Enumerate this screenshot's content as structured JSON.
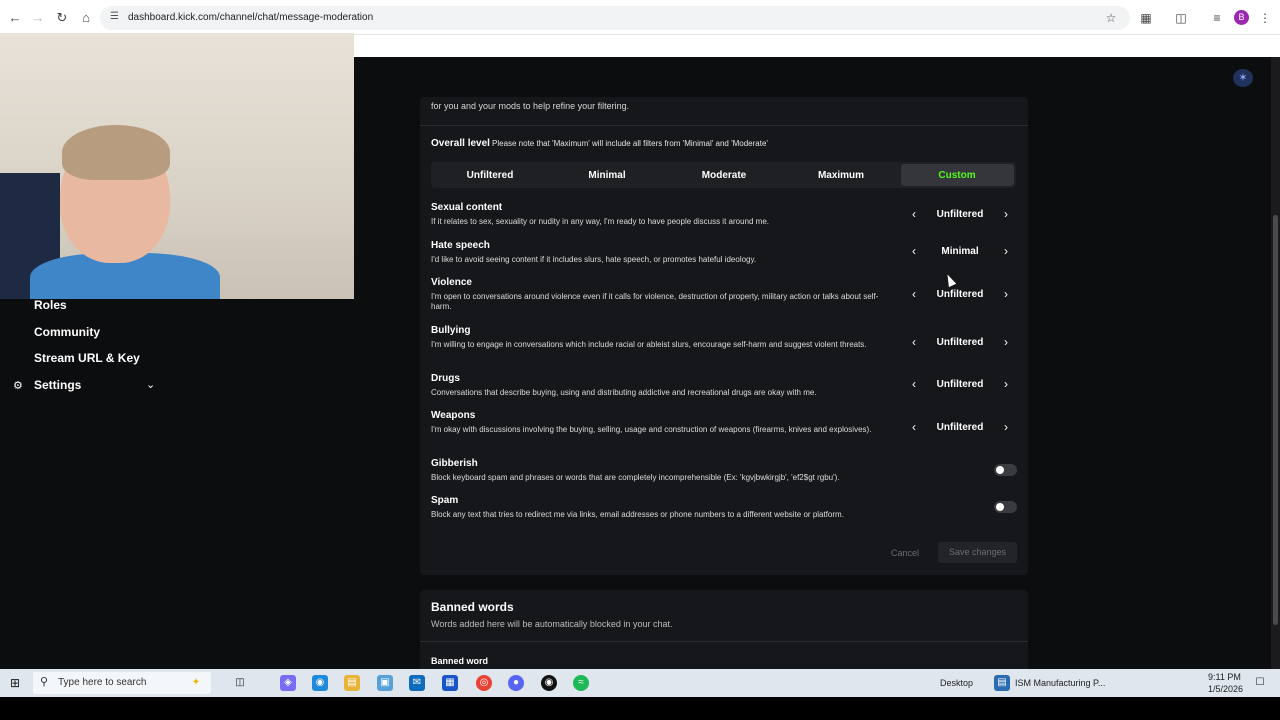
{
  "browser": {
    "url": "dashboard.kick.com/channel/chat/message-moderation",
    "nav_icons": [
      "back-icon",
      "forward-icon",
      "reload-icon",
      "home-icon"
    ],
    "profile_initial": "B"
  },
  "sidebar": {
    "items": [
      {
        "label": "Roles"
      },
      {
        "label": "Community"
      },
      {
        "label": "Stream URL & Key"
      },
      {
        "label": "Settings"
      }
    ]
  },
  "filtering": {
    "intro_text": "for you and your mods to help refine your filtering.",
    "overall_title": "Overall level",
    "overall_note": "Please note that 'Maximum' will include all filters from 'Minimal' and 'Moderate'",
    "levels": [
      "Unfiltered",
      "Minimal",
      "Moderate",
      "Maximum",
      "Custom"
    ],
    "active_level": "Custom",
    "active_color": "#53fc18",
    "categories": [
      {
        "title": "Sexual content",
        "desc": "If it relates to sex, sexuality or nudity in any way, I'm ready to have people discuss it around me.",
        "value": "Unfiltered"
      },
      {
        "title": "Hate speech",
        "desc": "I'd like to avoid seeing content if it includes slurs, hate speech, or promotes hateful ideology.",
        "value": "Minimal"
      },
      {
        "title": "Violence",
        "desc": "I'm open to conversations around violence even if it calls for violence, destruction of property, military action or talks about self-harm.",
        "value": "Unfiltered"
      },
      {
        "title": "Bullying",
        "desc": "I'm willing to engage in conversations which include racial or ableist slurs, encourage self-harm and suggest violent threats.",
        "value": "Unfiltered"
      },
      {
        "title": "Drugs",
        "desc": "Conversations that describe buying, using and distributing addictive and recreational drugs are okay with me.",
        "value": "Unfiltered"
      },
      {
        "title": "Weapons",
        "desc": "I'm okay with discussions involving the buying, selling, usage and construction of weapons (firearms, knives and explosives).",
        "value": "Unfiltered"
      }
    ],
    "toggles": [
      {
        "title": "Gibberish",
        "desc": "Block keyboard spam and phrases or words that are completely incomprehensible (Ex: 'kgvjbwkirgjb', 'ef2$gt rgbu').",
        "on": false
      },
      {
        "title": "Spam",
        "desc": "Block any text that tries to redirect me via links, email addresses or phone numbers to a different website or platform.",
        "on": false
      }
    ],
    "cancel_label": "Cancel",
    "save_label": "Save changes"
  },
  "banned": {
    "title": "Banned words",
    "desc": "Words added here will be automatically blocked in your chat.",
    "column": "Banned word"
  },
  "taskbar": {
    "search_placeholder": "Type here to search",
    "desktop_label": "Desktop",
    "app_label": "ISM Manufacturing P...",
    "time": "9:11 PM",
    "date": "1/5/2026"
  }
}
